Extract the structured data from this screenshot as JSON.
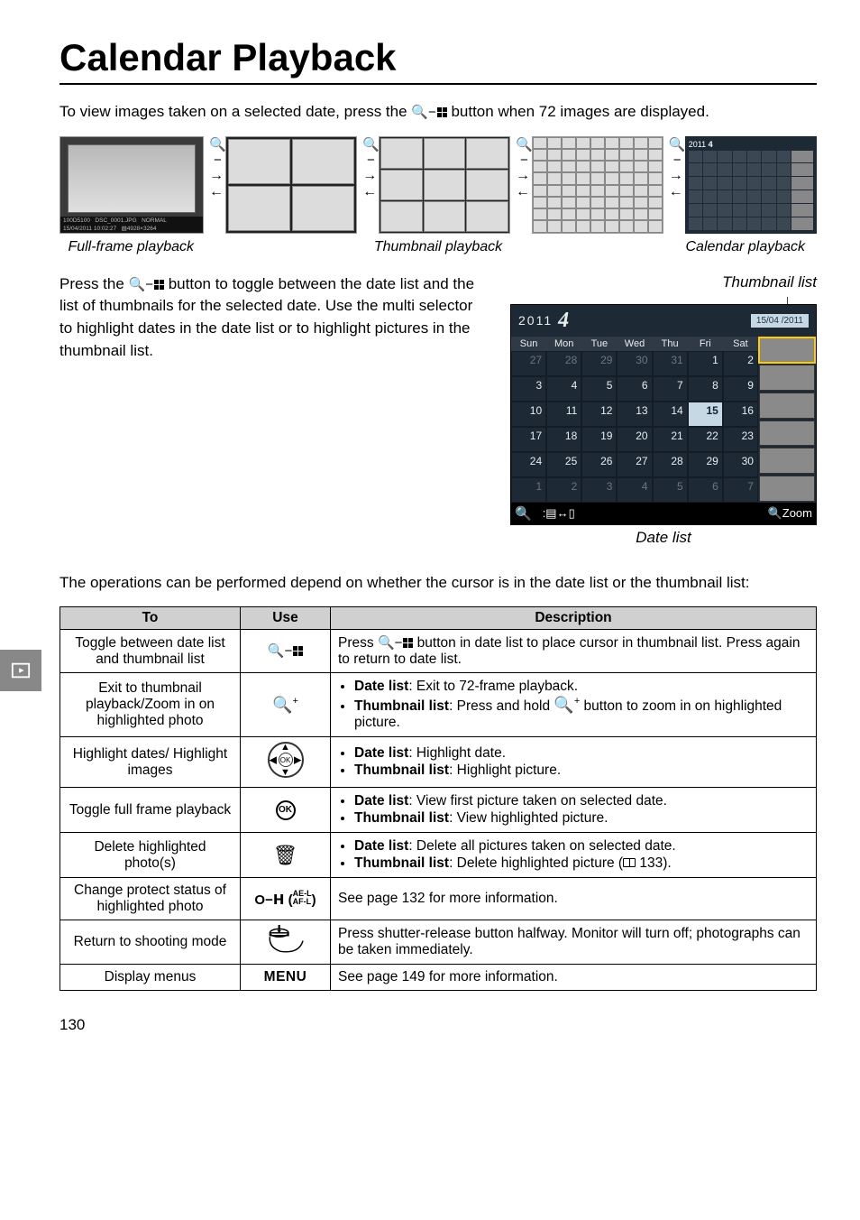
{
  "title": "Calendar Playback",
  "intro": "To view images taken on a selected date, press the ",
  "intro_after": " button when 72 images are displayed.",
  "captions": {
    "full_frame": "Full-frame playback",
    "thumb_playback": "Thumbnail playback",
    "calendar_playback": "Calendar playback",
    "thumbnail_list": "Thumbnail list",
    "date_list": "Date list"
  },
  "para2a": "Press the ",
  "para2b": " button to toggle between the date list and the list of thumbnails for the selected date.  Use the multi selector to highlight dates in the date list or to highlight pictures in the thumbnail list.",
  "para3": "The operations can be performed depend on whether the cursor is in the date list or the thumbnail list:",
  "calendar": {
    "year": "2011",
    "month": "4",
    "date_badge": "15/04 /2011",
    "dow": [
      "Sun",
      "Mon",
      "Tue",
      "Wed",
      "Thu",
      "Fri",
      "Sat"
    ],
    "days": [
      {
        "n": "27",
        "dim": true
      },
      {
        "n": "28",
        "dim": true
      },
      {
        "n": "29",
        "dim": true
      },
      {
        "n": "30",
        "dim": true
      },
      {
        "n": "31",
        "dim": true
      },
      {
        "n": "1"
      },
      {
        "n": "2"
      },
      {
        "n": "3"
      },
      {
        "n": "4"
      },
      {
        "n": "5"
      },
      {
        "n": "6"
      },
      {
        "n": "7"
      },
      {
        "n": "8"
      },
      {
        "n": "9"
      },
      {
        "n": "10"
      },
      {
        "n": "11"
      },
      {
        "n": "12"
      },
      {
        "n": "13"
      },
      {
        "n": "14"
      },
      {
        "n": "15",
        "sel": true
      },
      {
        "n": "16"
      },
      {
        "n": "17"
      },
      {
        "n": "18"
      },
      {
        "n": "19"
      },
      {
        "n": "20"
      },
      {
        "n": "21"
      },
      {
        "n": "22"
      },
      {
        "n": "23"
      },
      {
        "n": "24"
      },
      {
        "n": "25"
      },
      {
        "n": "26"
      },
      {
        "n": "27"
      },
      {
        "n": "28"
      },
      {
        "n": "29"
      },
      {
        "n": "30"
      },
      {
        "n": "1",
        "dim": true
      },
      {
        "n": "2",
        "dim": true
      },
      {
        "n": "3",
        "dim": true
      },
      {
        "n": "4",
        "dim": true
      },
      {
        "n": "5",
        "dim": true
      },
      {
        "n": "6",
        "dim": true
      },
      {
        "n": "7",
        "dim": true
      }
    ],
    "zoom_label": "Zoom"
  },
  "table": {
    "headers": {
      "to": "To",
      "use": "Use",
      "desc": "Description"
    },
    "rows": [
      {
        "to": "Toggle between date list and thumbnail list",
        "use_key": "qbox",
        "desc_type": "text",
        "desc_pre": "Press ",
        "desc_post": " button in date list to place cursor in thumbnail list.  Press again to return to date list."
      },
      {
        "to": "Exit to thumbnail playback/Zoom in on highlighted photo",
        "use_key": "magplus",
        "desc_type": "bullets",
        "bullets": [
          {
            "label": "Date list",
            "rest": ": Exit to 72-frame playback."
          },
          {
            "label": "Thumbnail list",
            "rest": ": Press and hold ",
            "icon": "magplus",
            "rest2": " button to zoom in on highlighted picture."
          }
        ]
      },
      {
        "to": "Highlight dates/ Highlight images",
        "use_key": "multiselector",
        "desc_type": "bullets",
        "bullets": [
          {
            "label": "Date list",
            "rest": ": Highlight date."
          },
          {
            "label": "Thumbnail list",
            "rest": ": Highlight picture."
          }
        ]
      },
      {
        "to": "Toggle full frame playback",
        "use_key": "ok",
        "desc_type": "bullets",
        "bullets": [
          {
            "label": "Date list",
            "rest": ": View first picture taken on selected date."
          },
          {
            "label": "Thumbnail list",
            "rest": ": View highlighted picture."
          }
        ]
      },
      {
        "to": "Delete highlighted photo(s)",
        "use_key": "trash",
        "desc_type": "bullets",
        "bullets": [
          {
            "label": "Date list",
            "rest": ": Delete all pictures taken on selected date."
          },
          {
            "label": "Thumbnail list",
            "rest": ": Delete highlighted picture (",
            "icon": "book",
            "rest2": " 133)."
          }
        ]
      },
      {
        "to": "Change protect status of highlighted photo",
        "use_key": "protect",
        "desc_type": "text_plain",
        "desc": "See page 132 for more information."
      },
      {
        "to": "Return to shooting mode",
        "use_key": "shutter",
        "desc_type": "text_plain",
        "desc": "Press shutter-release button halfway.  Monitor will turn off; photographs can be taken immediately."
      },
      {
        "to": "Display menus",
        "use_key": "menu",
        "use_text": "MENU",
        "desc_type": "text_plain",
        "desc": "See page 149 for more information."
      }
    ]
  },
  "pagenum": "130"
}
